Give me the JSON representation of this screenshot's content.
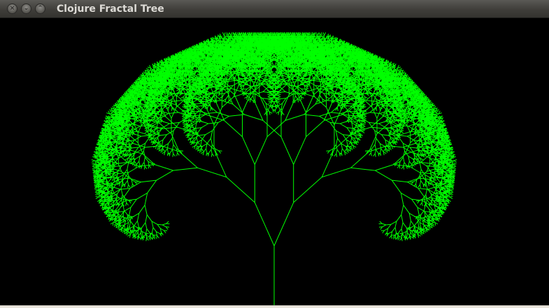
{
  "window": {
    "title": "Clojure Fractal Tree",
    "controls": {
      "close_icon": "close-icon",
      "close_glyph": "×",
      "minimize_icon": "minimize-icon",
      "minimize_glyph": "⌄",
      "maximize_icon": "maximize-icon",
      "maximize_glyph": "⌃"
    }
  },
  "canvas": {
    "background": "#000000",
    "tree_color": "#00ff00"
  }
}
